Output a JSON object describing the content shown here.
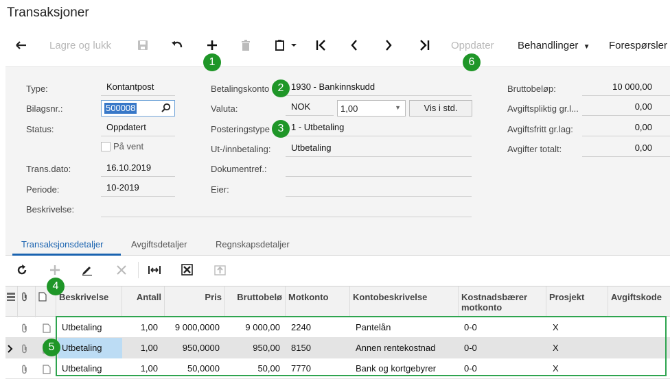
{
  "page_title": "Transaksjoner",
  "toolbar": {
    "save_close": "Lagre og lukk",
    "update": "Oppdater",
    "actions": "Behandlinger",
    "inquiries": "Forespørsler"
  },
  "badges": [
    "1",
    "2",
    "3",
    "4",
    "5",
    "6"
  ],
  "form": {
    "type_label": "Type:",
    "type_value": "Kontantpost",
    "voucher_label": "Bilagsnr.:",
    "voucher_value": "500008",
    "status_label": "Status:",
    "status_value": "Oppdatert",
    "on_hold_label": "På vent",
    "trans_date_label": "Trans.dato:",
    "trans_date_value": "16.10.2019",
    "period_label": "Periode:",
    "period_value": "10-2019",
    "description_label": "Beskrivelse:",
    "payment_account_label": "Betalingskonto",
    "payment_account_value": "1930 - Bankinnskudd",
    "currency_label": "Valuta:",
    "currency_value": "NOK",
    "rate_value": "1,00",
    "show_std_button": "Vis i std.",
    "posting_type_label": "Posteringstype",
    "posting_type_value": "1 - Utbetaling",
    "in_out_label": "Ut-/innbetaling:",
    "in_out_value": "Utbetaling",
    "docref_label": "Dokumentref.:",
    "owner_label": "Eier:",
    "gross_label": "Bruttobeløp:",
    "gross_value": "10 000,00",
    "taxable_label": "Avgiftspliktig gr.l...",
    "taxable_value": "0,00",
    "taxfree_label": "Avgiftsfritt gr.lag:",
    "taxfree_value": "0,00",
    "tax_total_label": "Avgifter totalt:",
    "tax_total_value": "0,00"
  },
  "tabs": [
    "Transaksjonsdetaljer",
    "Avgiftsdetaljer",
    "Regnskapsdetaljer"
  ],
  "grid": {
    "headers": {
      "description": "Beskrivelse",
      "quantity": "Antall",
      "price": "Pris",
      "gross": "Bruttobelø",
      "offset_account": "Motkonto",
      "account_desc": "Kontobeskrivelse",
      "cost_bearer_1": "Kostnadsbærer",
      "cost_bearer_2": "motkonto",
      "project": "Prosjekt",
      "tax_code": "Avgiftskode"
    },
    "rows": [
      {
        "description": "Utbetaling",
        "quantity": "1,00",
        "price": "9 000,0000",
        "gross": "9 000,00",
        "account": "2240",
        "account_desc": "Pantelån",
        "cost": "0-0",
        "project": "X"
      },
      {
        "description": "Utbetaling",
        "quantity": "1,00",
        "price": "950,0000",
        "gross": "950,00",
        "account": "8150",
        "account_desc": "Annen rentekostnad",
        "cost": "0-0",
        "project": "X"
      },
      {
        "description": "Utbetaling",
        "quantity": "1,00",
        "price": "50,0000",
        "gross": "50,00",
        "account": "7770",
        "account_desc": "Bank og kortgebyrer",
        "cost": "0-0",
        "project": "X"
      }
    ]
  },
  "colors": {
    "accent": "#1a63b0",
    "badge": "#1f9628",
    "highlight": "#2ea44f",
    "selected_cell": "#bcdcf4"
  }
}
